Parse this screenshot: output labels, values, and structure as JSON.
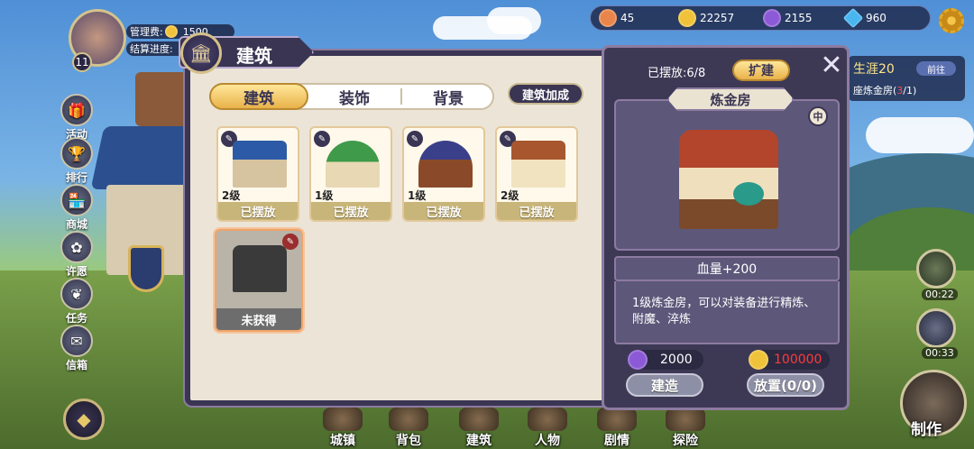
{
  "resources": {
    "stamina": "45",
    "gold": "22257",
    "purple": "2155",
    "diamond": "960"
  },
  "player": {
    "level": "11",
    "mgmt_label": "管理费:",
    "mgmt_value": "1500",
    "progress_label": "结算进度:"
  },
  "side_menu": [
    "活动",
    "排行",
    "商城",
    "许愿",
    "任务",
    "信箱"
  ],
  "bottom_nav": [
    "城镇",
    "背包",
    "建筑",
    "人物",
    "剧情",
    "探险"
  ],
  "craft_label": "制作",
  "quest": {
    "title": "生涯20",
    "button": "前往",
    "sub": "座炼金房(",
    "progress_num": "3",
    "progress_total": "/1)"
  },
  "timers": [
    "00:22",
    "00:33"
  ],
  "panel": {
    "title": "建筑",
    "tabs": [
      "建筑",
      "装饰",
      "背景"
    ],
    "bonus_button": "建筑加成",
    "cards": [
      {
        "level": "2级",
        "status": "已摆放"
      },
      {
        "level": "1级",
        "status": "已摆放"
      },
      {
        "level": "1级",
        "status": "已摆放"
      },
      {
        "level": "2级",
        "status": "已摆放"
      }
    ],
    "locked_card": {
      "status": "未获得"
    }
  },
  "detail": {
    "placed": "已摆放:6/8",
    "expand_button": "扩建",
    "name": "炼金房",
    "medal": "中",
    "stat": "血量+200",
    "description": "1级炼金房，可以对装备进行精炼、附魔、淬炼",
    "cost_purple": "2000",
    "cost_gold": "100000",
    "build_button": "建造",
    "place_button": "放置(0/0)"
  },
  "colors": {
    "panel_dark": "#3a3553",
    "gold_button": "#e9b24a",
    "cost_red": "#ff3b3b"
  }
}
